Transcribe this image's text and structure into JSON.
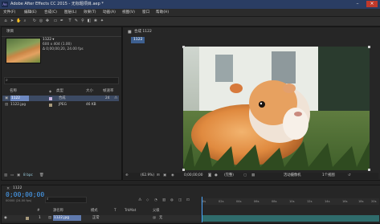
{
  "window": {
    "title": "Adobe After Effects CC 2015 - 无标题项目.aep *",
    "logo": "Ae"
  },
  "menu": [
    "文件(F)",
    "编辑(E)",
    "合成(C)",
    "图层(L)",
    "效果(T)",
    "动画(A)",
    "视图(V)",
    "窗口",
    "帮助(H)"
  ],
  "project": {
    "tab": "项目",
    "item_name": "1122 ▾",
    "item_info": [
      "600 x 404 (1.00)",
      "Δ 0;00;00;20, 24.00 fps"
    ],
    "columns": [
      "名称",
      "类型",
      "大小",
      "帧速率"
    ],
    "rows": [
      {
        "name": "1122",
        "type": "合成",
        "size": "",
        "fps": "24",
        "selected": true
      },
      {
        "name": "1122.jpg",
        "type": "JPEG",
        "size": "46 KB",
        "fps": "",
        "selected": false
      }
    ],
    "footer_bpc": "8 bpc"
  },
  "viewer": {
    "tab": "合成 1122",
    "sub_tab": "1122",
    "zoom": "(62.9%)",
    "timecode": "0;00;00;00",
    "resolution": "(完整)",
    "camera": "活动摄像机",
    "views": "1个视图"
  },
  "timeline": {
    "tab": "1122",
    "time": "0;00;00;00",
    "frames": "00000 (24.00 fps)",
    "columns": [
      "#",
      "源名称",
      "模式",
      "T",
      "TrkMat",
      "父级"
    ],
    "layer": {
      "index": "1",
      "name": "1122.jpg",
      "mode": "正常",
      "parent": "无"
    },
    "ruler_ticks": [
      "0s",
      "02s",
      "04s",
      "06s",
      "08s",
      "10s",
      "12s",
      "14s",
      "16s",
      "18s",
      "20s"
    ]
  },
  "colors": {
    "accent": "#4aa6ff",
    "title_bar": "#2a3d63",
    "layer_bar": "#2f6c6c"
  }
}
